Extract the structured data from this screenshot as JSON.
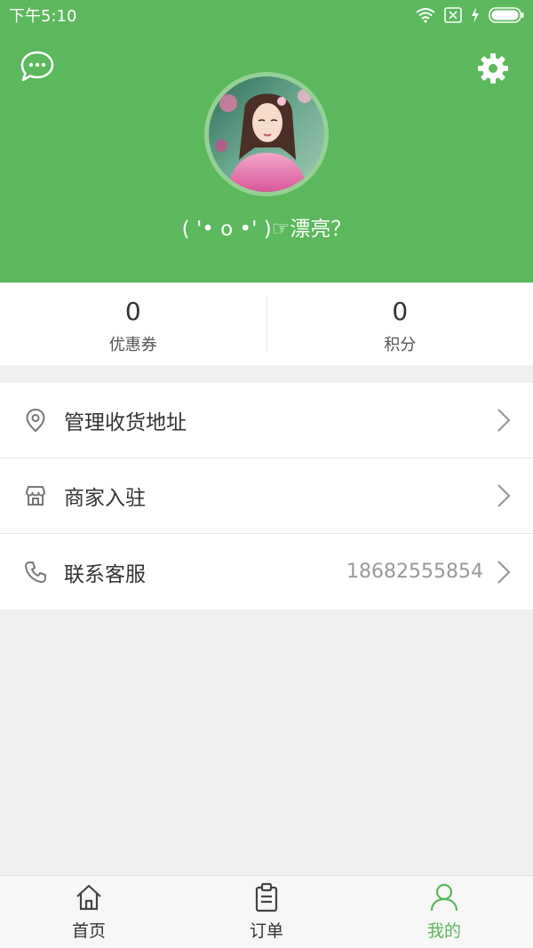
{
  "status_bar": {
    "time": "下午5:10"
  },
  "header": {
    "nickname": "( '• o •' )☞漂亮？"
  },
  "stats": [
    {
      "value": "0",
      "label": "优惠券"
    },
    {
      "value": "0",
      "label": "积分"
    }
  ],
  "menu": [
    {
      "label": "管理收货地址",
      "icon": "location-pin-icon"
    },
    {
      "label": "商家入驻",
      "icon": "store-icon"
    },
    {
      "label": "联系客服",
      "icon": "phone-icon",
      "value": "18682555854"
    }
  ],
  "tabbar": {
    "active": 2,
    "items": [
      {
        "label": "首页",
        "icon": "home-icon"
      },
      {
        "label": "订单",
        "icon": "clipboard-icon"
      },
      {
        "label": "我的",
        "icon": "user-icon"
      }
    ]
  },
  "colors": {
    "primary": "#5cb85c",
    "background": "#efefef",
    "text": "#333333",
    "muted": "#999999"
  }
}
